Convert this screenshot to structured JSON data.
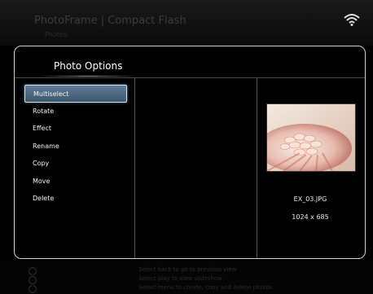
{
  "background": {
    "header_title": "PhotoFrame | Compact Flash",
    "header_sub": "Photos",
    "footer_hints": [
      "Select back to go to previous view",
      "Select play to view slideshow",
      "Select menu to create, copy and delete photos"
    ]
  },
  "dialog": {
    "title": "Photo Options",
    "menu_items": [
      {
        "label": "Multiselect",
        "selected": true
      },
      {
        "label": "Rotate"
      },
      {
        "label": "Effect"
      },
      {
        "label": "Rename"
      },
      {
        "label": "Copy"
      },
      {
        "label": "Move"
      },
      {
        "label": "Delete"
      }
    ],
    "preview": {
      "file_name": "EX_03.JPG",
      "dimensions": "1024 x 685"
    }
  },
  "colors": {
    "selection": "#4a6a84",
    "dialog_border": "#cfcfcf"
  },
  "icons": [
    "wifi-icon",
    "back-icon",
    "play-icon",
    "menu-icon"
  ]
}
